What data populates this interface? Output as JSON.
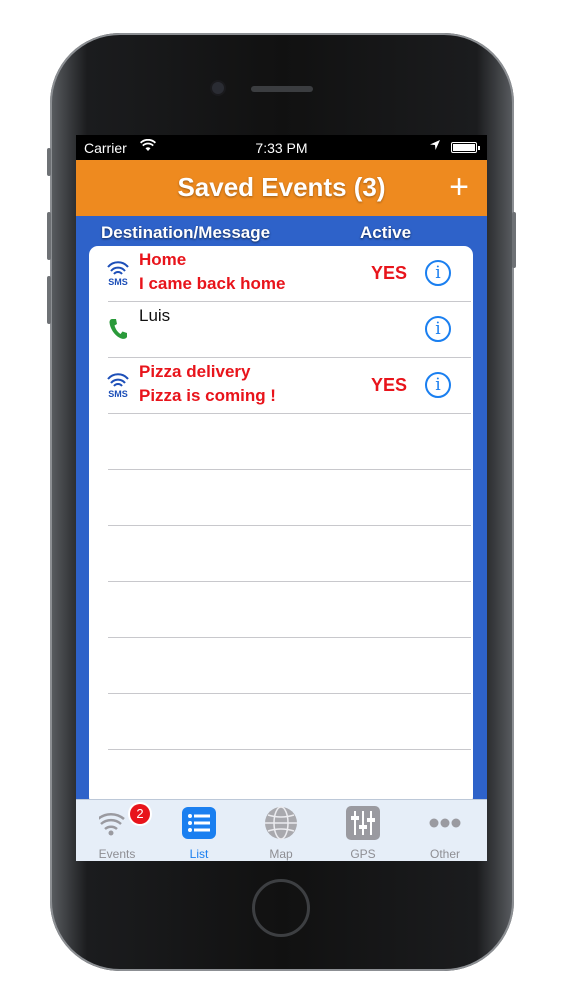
{
  "status_bar": {
    "carrier": "Carrier",
    "time": "7:33 PM"
  },
  "nav": {
    "title": "Saved Events (3)",
    "add_label": "+"
  },
  "columns": {
    "destination": "Destination/Message",
    "active": "Active"
  },
  "rows": [
    {
      "type": "sms",
      "line1": "Home",
      "line2": "I came back home",
      "active": "YES",
      "style": "red"
    },
    {
      "type": "phone",
      "line1": "Luis",
      "line2": "",
      "active": "",
      "style": "black"
    },
    {
      "type": "sms",
      "line1": "Pizza delivery",
      "line2": "Pizza is coming !",
      "active": "YES",
      "style": "red"
    }
  ],
  "icons": {
    "sms_label": "SMS",
    "info_glyph": "i"
  },
  "tabs": [
    {
      "label": "Events",
      "icon": "events-wifi-icon",
      "badge": "2"
    },
    {
      "label": "List",
      "icon": "list-icon",
      "active": true
    },
    {
      "label": "Map",
      "icon": "globe-icon"
    },
    {
      "label": "GPS",
      "icon": "sliders-icon"
    },
    {
      "label": "Other",
      "icon": "more-dots-icon"
    }
  ],
  "colors": {
    "nav": "#ee8a1f",
    "table_bg": "#2e62c9",
    "alert": "#e8141b",
    "accent": "#1a7ff0"
  }
}
